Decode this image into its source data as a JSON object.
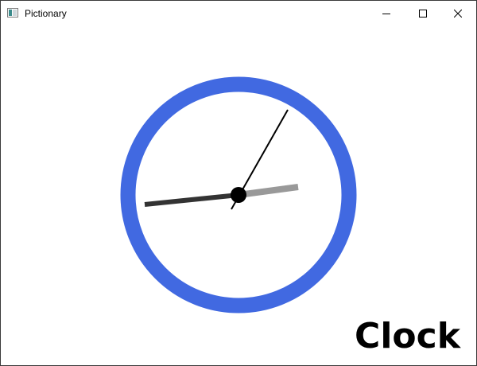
{
  "window": {
    "title": "Pictionary",
    "controls": {
      "minimize_icon": "minimize-icon",
      "maximize_icon": "maximize-icon",
      "close_icon": "close-icon"
    }
  },
  "drawing": {
    "subject": "clock-icon",
    "caption": "Clock",
    "colors": {
      "rim": "#4169e1",
      "face": "#ffffff",
      "hour_hand": "#333333",
      "minute_hand": "#999999",
      "second_hand": "#000000",
      "center_pin": "#000000"
    }
  }
}
